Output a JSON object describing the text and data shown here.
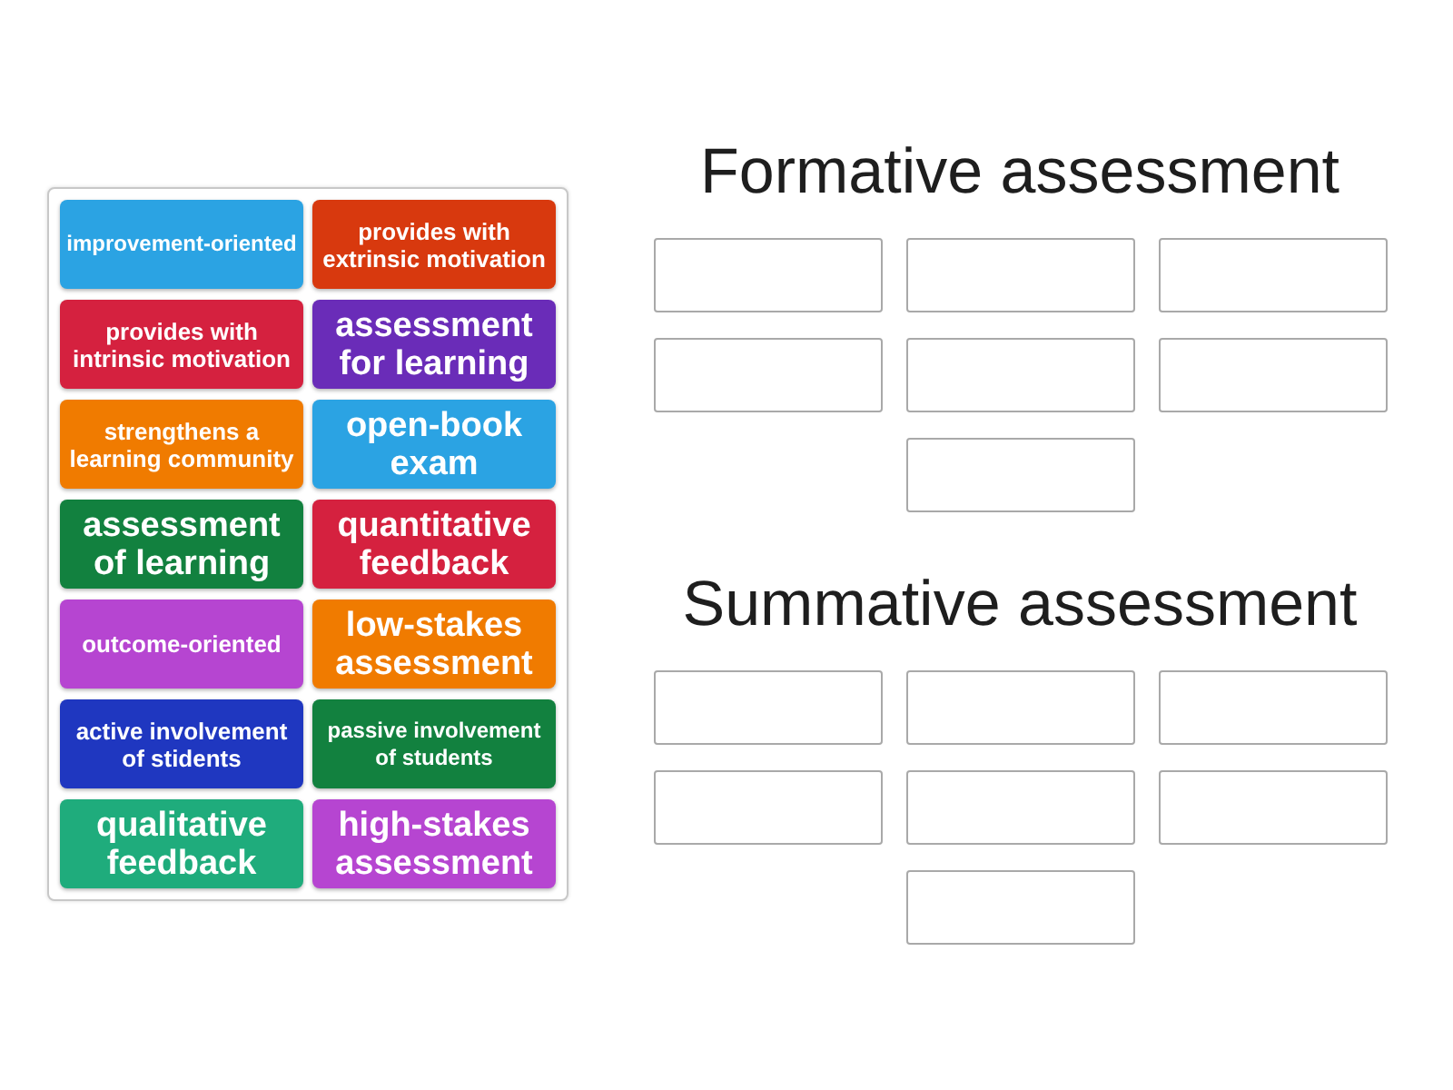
{
  "cards": [
    {
      "text": "improvement-oriented",
      "kind": "small",
      "color": "#2ba3e3"
    },
    {
      "text": "provides with intrinsic motivation",
      "kind": "medium",
      "color": "#d5213f"
    },
    {
      "text": "strengthens a learning community",
      "kind": "medium",
      "color": "#f07b00"
    },
    {
      "text": "assessment of learning",
      "kind": "large",
      "color": "#12813f"
    },
    {
      "text": "outcome-oriented",
      "kind": "medium",
      "color": "#b645d1"
    },
    {
      "text": "active involvement of stidents",
      "kind": "medium",
      "color": "#1f37c0"
    },
    {
      "text": "qualitative feedback",
      "kind": "large",
      "color": "#1fac7c"
    },
    {
      "text": "provides with extrinsic motivation",
      "kind": "medium",
      "color": "#d8390e"
    },
    {
      "text": "assessment for learning",
      "kind": "large",
      "color": "#6a2cb8"
    },
    {
      "text": "open-book exam",
      "kind": "large",
      "color": "#2ba3e3"
    },
    {
      "text": "quantitative feedback",
      "kind": "large",
      "color": "#d5213f"
    },
    {
      "text": "low-stakes assessment",
      "kind": "large",
      "color": "#f07b00"
    },
    {
      "text": "passive involvement of students",
      "kind": "small",
      "color": "#12813f"
    },
    {
      "text": "high-stakes assessment",
      "kind": "large",
      "color": "#b645d1"
    }
  ],
  "categories": [
    {
      "title": "Formative assessment",
      "slots": [
        {
          "kind": "empty"
        },
        {
          "kind": "empty"
        },
        {
          "kind": "empty"
        },
        {
          "kind": "empty"
        },
        {
          "kind": "empty"
        },
        {
          "kind": "empty"
        },
        {
          "kind": "empty"
        }
      ]
    },
    {
      "title": "Summative assessment",
      "slots": [
        {
          "kind": "empty"
        },
        {
          "kind": "empty"
        },
        {
          "kind": "empty"
        },
        {
          "kind": "empty"
        },
        {
          "kind": "empty"
        },
        {
          "kind": "empty"
        },
        {
          "kind": "empty"
        }
      ]
    }
  ]
}
